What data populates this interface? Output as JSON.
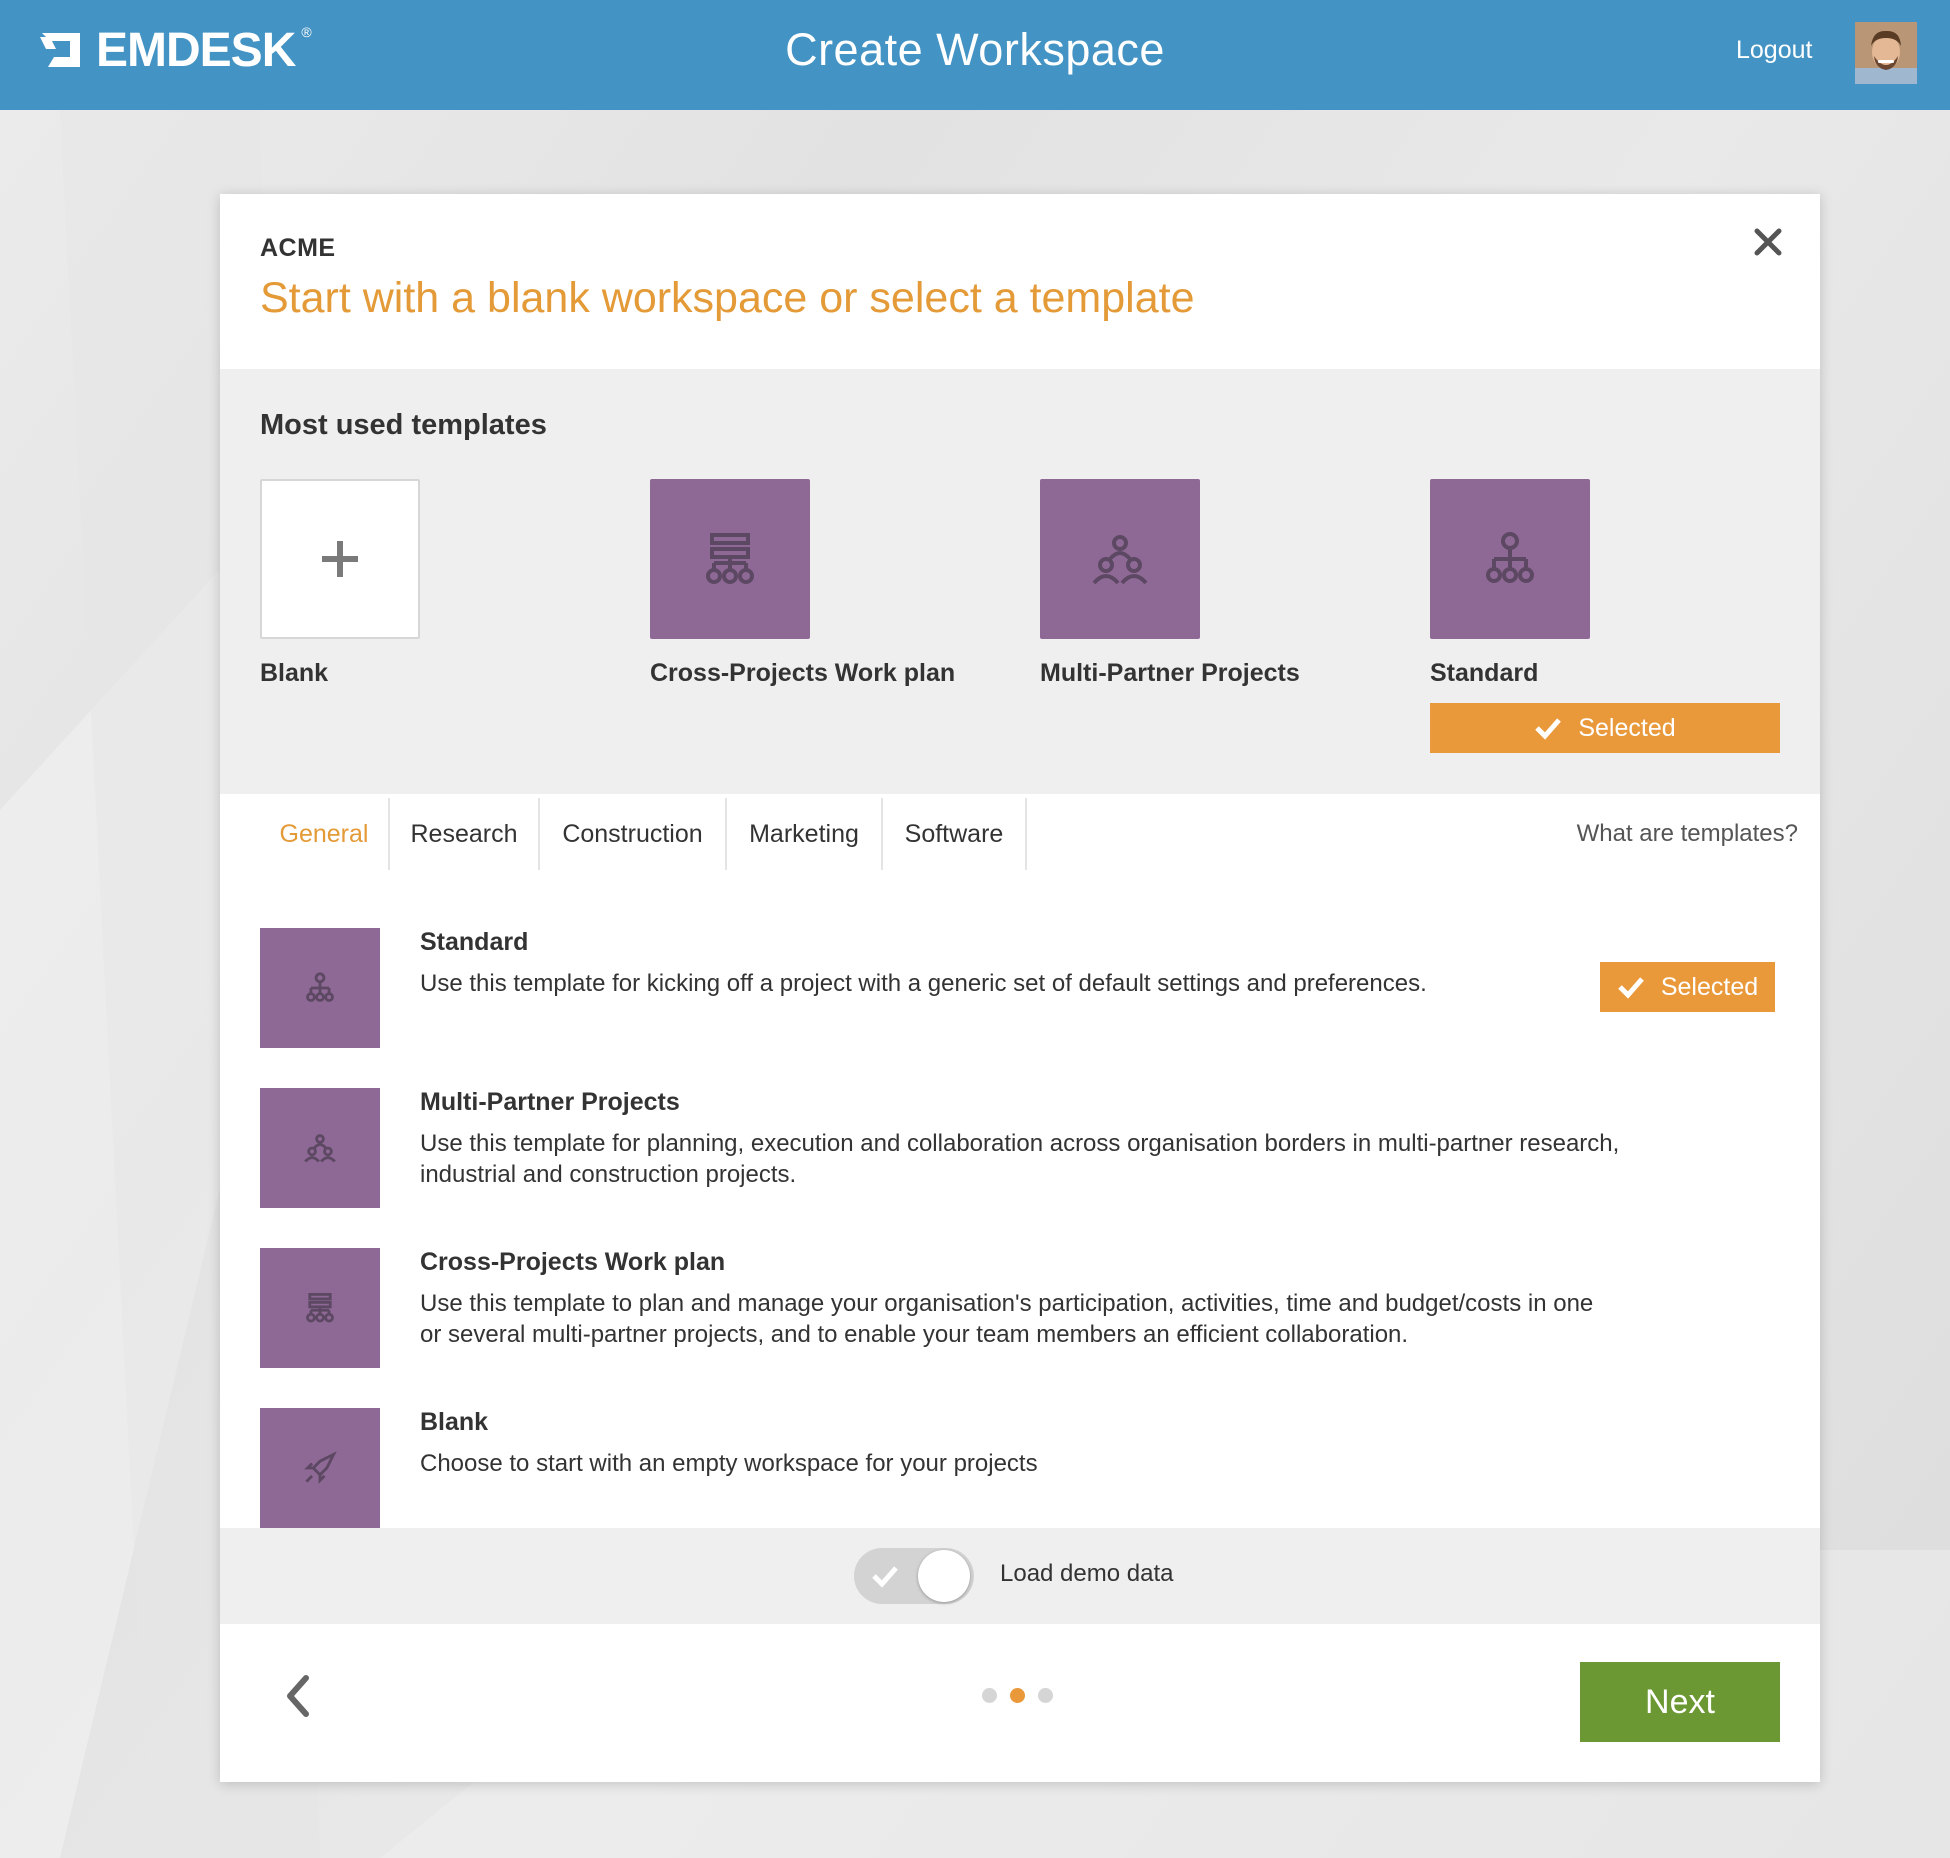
{
  "header": {
    "logo_text": "EMDESK",
    "logo_reg": "®",
    "title": "Create Workspace",
    "logout_label": "Logout"
  },
  "modal": {
    "org_name": "ACME",
    "heading": "Start with a blank workspace or select a template",
    "most_used": {
      "title": "Most used templates",
      "cards": [
        {
          "label": "Blank",
          "icon": "plus-icon"
        },
        {
          "label": "Cross-Projects Work plan",
          "icon": "work-plan-icon"
        },
        {
          "label": "Multi-Partner Projects",
          "icon": "partners-icon"
        },
        {
          "label": "Standard",
          "icon": "hierarchy-icon"
        }
      ],
      "selected_label": "Selected"
    },
    "tabs": [
      {
        "label": "General",
        "active": true
      },
      {
        "label": "Research"
      },
      {
        "label": "Construction"
      },
      {
        "label": "Marketing"
      },
      {
        "label": "Software"
      }
    ],
    "help_link": "What are templates?",
    "templates": [
      {
        "name": "Standard",
        "icon": "hierarchy-icon",
        "description": "Use this template for kicking off a project with a generic set of default settings and preferences.",
        "selected_label": "Selected"
      },
      {
        "name": "Multi-Partner Projects",
        "icon": "partners-icon",
        "description": "Use this template for planning, execution and collaboration across organisation borders in multi-partner research, industrial and construction projects."
      },
      {
        "name": "Cross-Projects Work plan",
        "icon": "work-plan-icon",
        "description": "Use this template to plan and manage your organisation's participation, activities, time and budget/costs in one or several multi-partner projects, and to enable your team members an efficient collaboration."
      },
      {
        "name": "Blank",
        "icon": "rocket-icon",
        "description": "Choose to start with an empty workspace for your projects"
      }
    ],
    "demo_data": {
      "label": "Load demo data",
      "enabled": true
    },
    "pager": {
      "total": 3,
      "current": 2
    },
    "next_label": "Next"
  },
  "colors": {
    "header_blue": "#4393c4",
    "accent_orange": "#e39a37",
    "tile_purple": "#8f6996",
    "next_green": "#6b9832"
  }
}
